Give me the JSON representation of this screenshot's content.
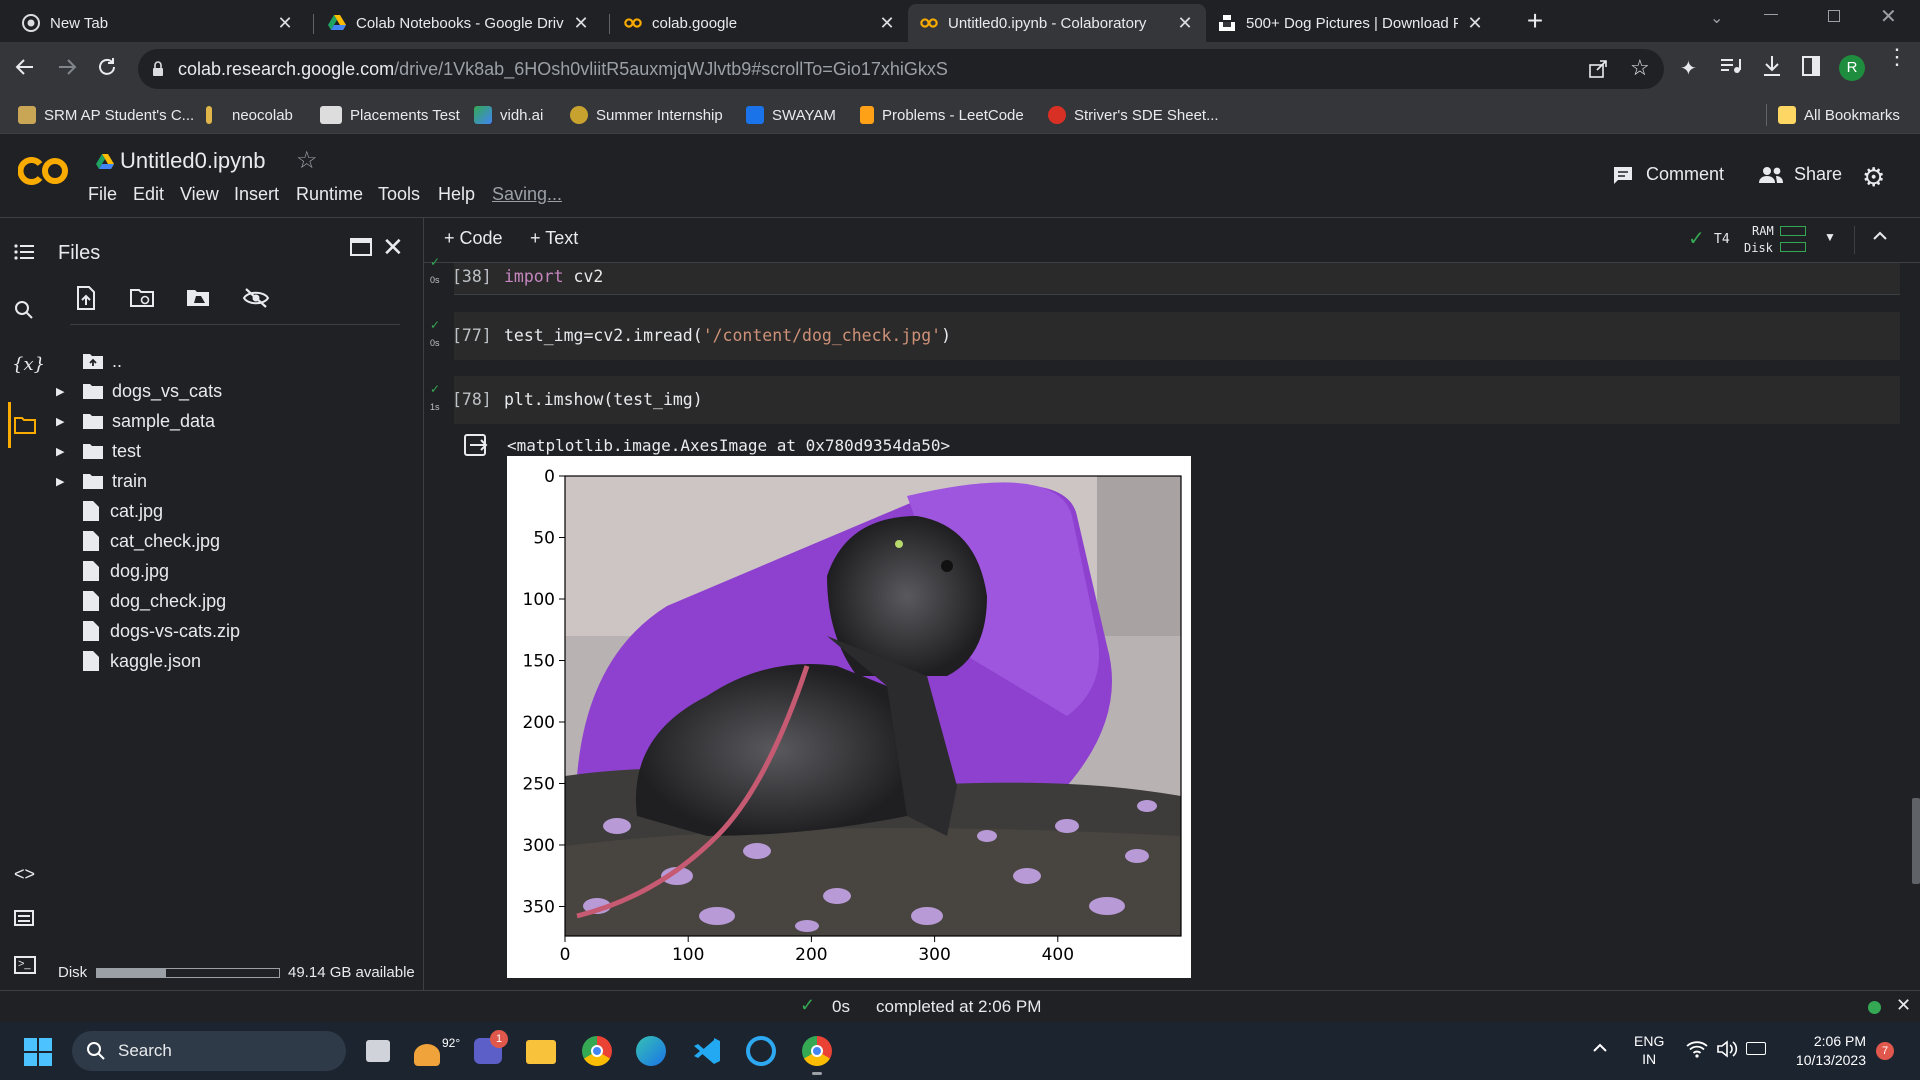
{
  "browser": {
    "tabs": [
      {
        "title": "New Tab",
        "icon": "chrome-icon"
      },
      {
        "title": "Colab Notebooks - Google Drive",
        "icon": "drive-icon"
      },
      {
        "title": "colab.google",
        "icon": "colab-icon"
      },
      {
        "title": "Untitled0.ipynb - Colaboratory",
        "icon": "colab-icon"
      },
      {
        "title": "500+ Dog Pictures | Download F",
        "icon": "unsplash-icon"
      }
    ],
    "url_host": "colab.research.google.com",
    "url_path": "/drive/1Vk8ab_6HOsh0vliitR5auxmjqWJlvtb9#scrollTo=Gio17xhiGkxS",
    "profile_letter": "R",
    "bookmarks": [
      "SRM AP Student's C...",
      "neocolab",
      "Placements Test",
      "vidh.ai",
      "Summer Internship",
      "SWAYAM",
      "Problems - LeetCode",
      "Striver's SDE Sheet..."
    ],
    "all_bookmarks": "All Bookmarks"
  },
  "colab": {
    "logo": "CO",
    "notebook_title": "Untitled0.ipynb",
    "menu": [
      "File",
      "Edit",
      "View",
      "Insert",
      "Runtime",
      "Tools",
      "Help"
    ],
    "saving": "Saving...",
    "comment": "Comment",
    "share": "Share",
    "add_code": "+ Code",
    "add_text": "+ Text",
    "runtime_type": "T4",
    "ram": "RAM",
    "disk": "Disk"
  },
  "files_panel": {
    "title": "Files",
    "parent": "..",
    "folders": [
      "dogs_vs_cats",
      "sample_data",
      "test",
      "train"
    ],
    "files": [
      "cat.jpg",
      "cat_check.jpg",
      "dog.jpg",
      "dog_check.jpg",
      "dogs-vs-cats.zip",
      "kaggle.json"
    ],
    "disk_label": "Disk",
    "disk_available": "49.14 GB available",
    "disk_used_fraction": 0.38
  },
  "cells": [
    {
      "exec": "[38]",
      "time": "0s",
      "code_kw": "import",
      "code_rest": " cv2"
    },
    {
      "exec": "[77]",
      "time": "0s",
      "code_pre": "test_img=cv2.imread(",
      "code_str": "'/content/dog_check.jpg'",
      "code_post": ")"
    },
    {
      "exec": "[78]",
      "time": "1s",
      "code_pre": "plt.imshow(test_img)"
    }
  ],
  "output_text": "<matplotlib.image.AxesImage at 0x780d9354da50>",
  "chart_data": {
    "type": "image",
    "xticks": [
      "0",
      "100",
      "200",
      "300",
      "400"
    ],
    "yticks": [
      "0",
      "50",
      "100",
      "150",
      "200",
      "250",
      "300",
      "350"
    ],
    "xlim": [
      0,
      500
    ],
    "ylim": [
      374,
      0
    ]
  },
  "status": {
    "time": "0s",
    "text": "completed at 2:06 PM"
  },
  "taskbar": {
    "search": "Search",
    "weather": "92°",
    "teams_badge": "1",
    "lang1": "ENG",
    "lang2": "IN",
    "clock_time": "2:06 PM",
    "clock_date": "10/13/2023",
    "notif_count": "7"
  }
}
